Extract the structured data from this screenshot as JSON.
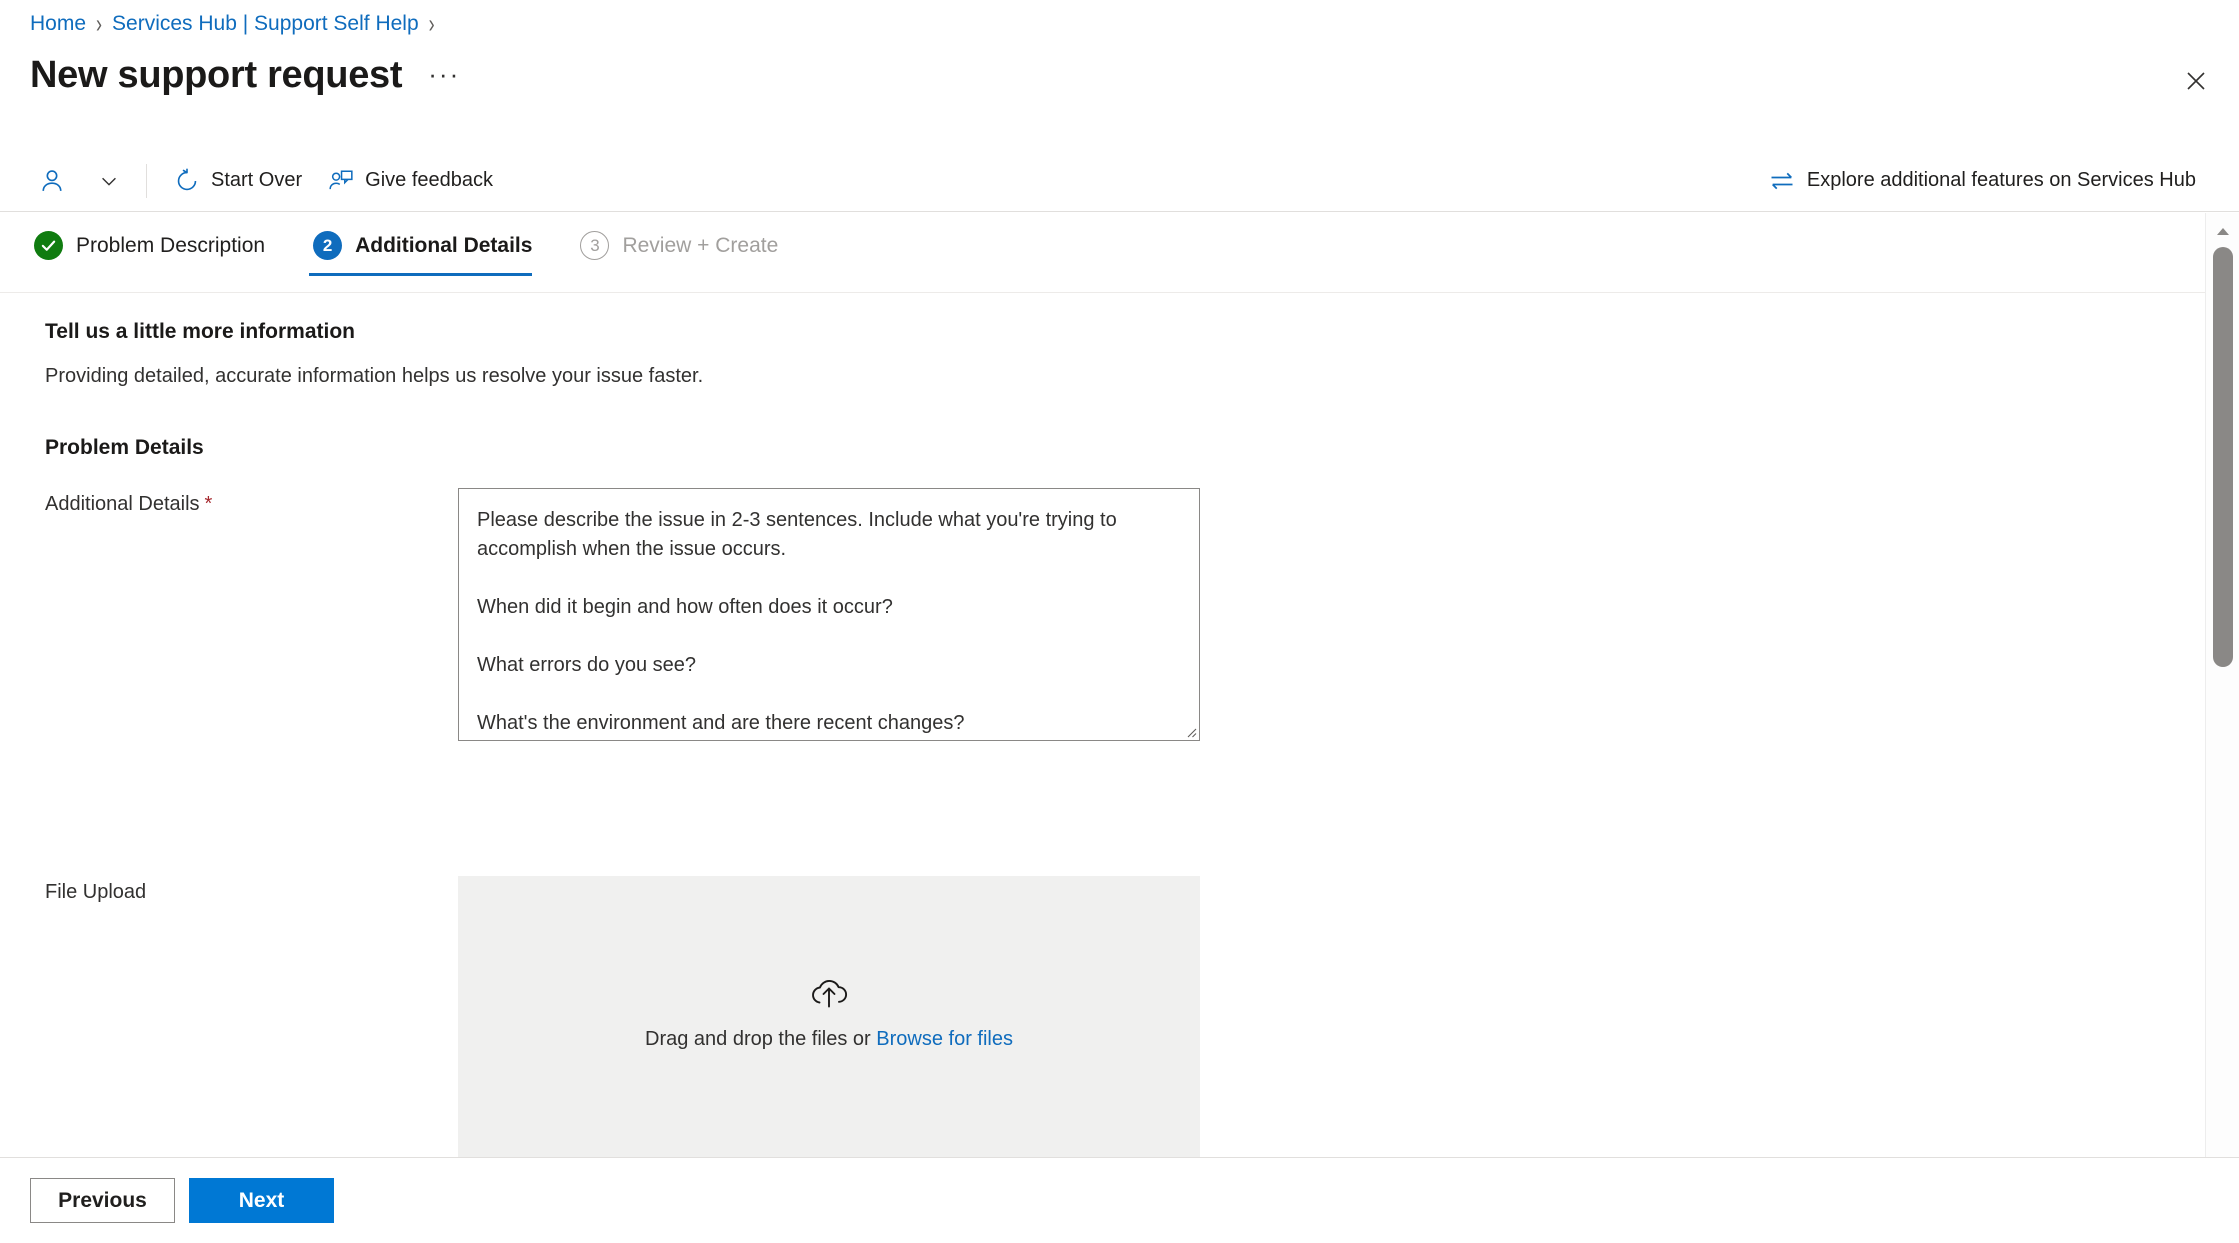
{
  "breadcrumb": {
    "items": [
      {
        "label": "Home"
      },
      {
        "label": "Services Hub | Support Self Help"
      }
    ],
    "separator": "›"
  },
  "header": {
    "title": "New support request",
    "more_label": "···",
    "close_label": "✕"
  },
  "commandbar": {
    "persona_icon": "person-icon",
    "persona_chevron": "chevron-down-icon",
    "items": [
      {
        "label": "Start Over",
        "icon": "refresh-icon"
      },
      {
        "label": "Give feedback",
        "icon": "person-feedback-icon"
      }
    ],
    "right_item": {
      "label": "Explore additional features on Services Hub",
      "icon": "swap-arrows-icon"
    }
  },
  "steps": [
    {
      "number": "",
      "label": "Problem Description",
      "state": "completed"
    },
    {
      "number": "2",
      "label": "Additional Details",
      "state": "active"
    },
    {
      "number": "3",
      "label": "Review + Create",
      "state": "todo"
    }
  ],
  "form": {
    "section_title": "Tell us a little more information",
    "section_subtitle": "Providing detailed, accurate information helps us resolve your issue faster.",
    "group_title": "Problem Details",
    "additional_details": {
      "label": "Additional Details",
      "required_marker": "*",
      "value": "",
      "placeholder": "Please describe the issue in 2-3 sentences. Include what you're trying to accomplish when the issue occurs.\n\nWhen did it begin and how often does it occur?\n\nWhat errors do you see?\n\nWhat's the environment and are there recent changes?\n\nWhat have you tried to troubleshoot this?"
    },
    "file_upload": {
      "label": "File Upload",
      "icon": "cloud-upload-icon",
      "drop_text": "Drag and drop the files or ",
      "browse_link": "Browse for files"
    }
  },
  "footer": {
    "previous_label": "Previous",
    "next_label": "Next"
  },
  "colors": {
    "link": "#0f6cbd",
    "primary_button": "#0078d4",
    "completed_step": "#107c10",
    "active_step": "#0f6cbd",
    "required_asterisk": "#a4262c",
    "dropzone_bg": "#f0f0ef"
  }
}
